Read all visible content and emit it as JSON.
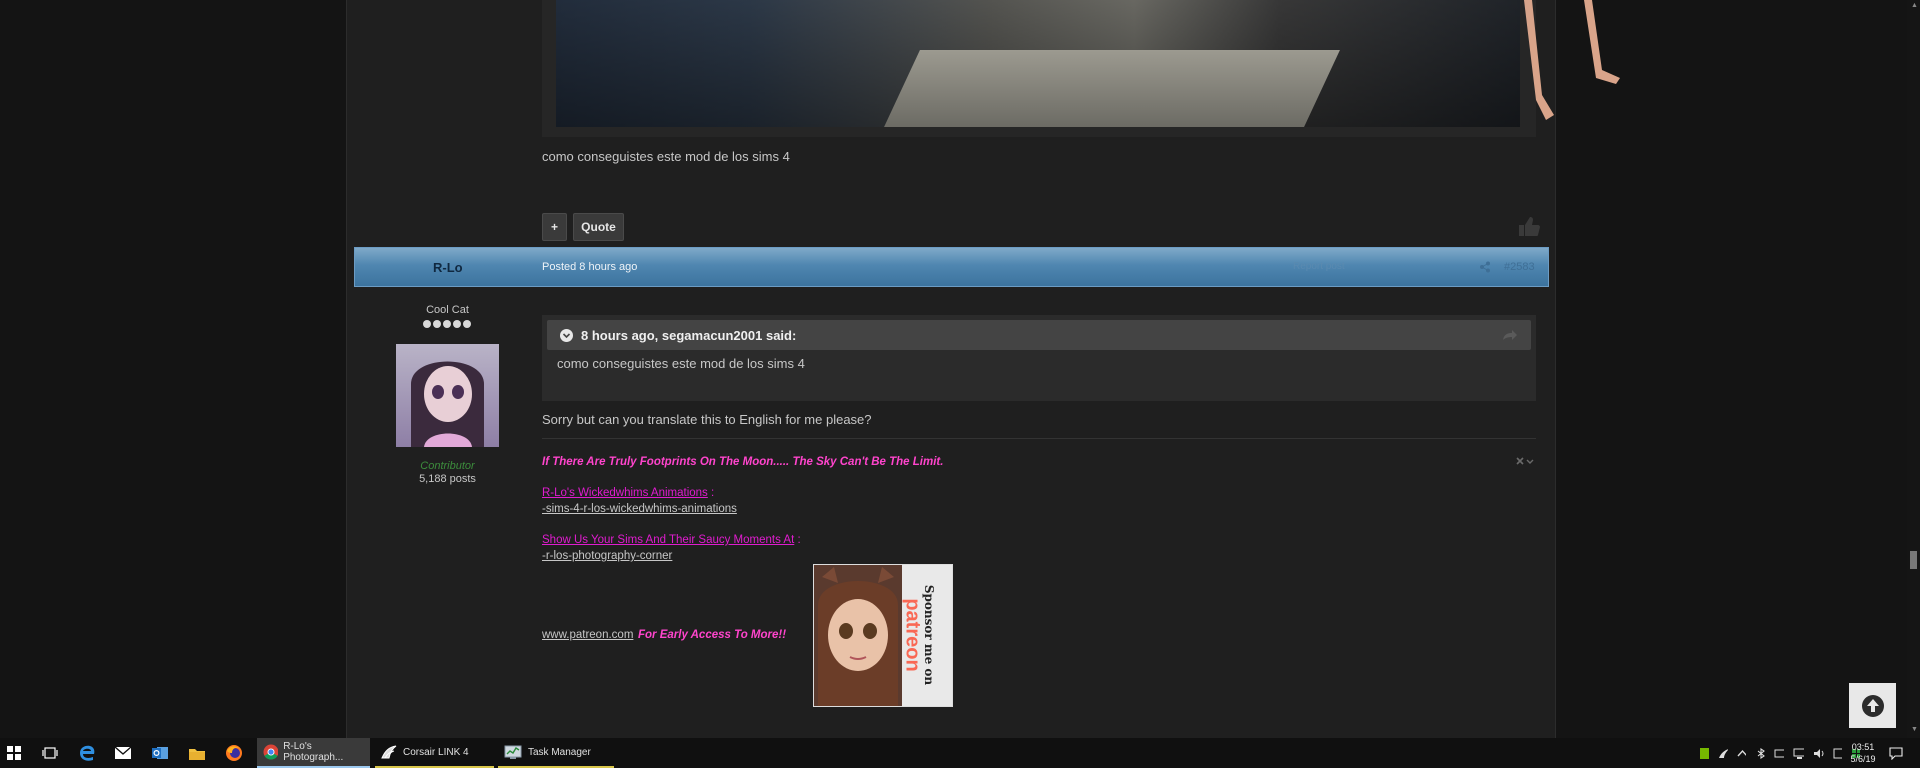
{
  "previous_post": {
    "comment": "como conseguistes este mod de los sims 4",
    "plus_label": "+",
    "quote_label": "Quote"
  },
  "post": {
    "author": "R-Lo",
    "posted": "Posted 8 hours ago",
    "report_text": "Report post",
    "number": "#2583",
    "rank": "Cool Cat",
    "role": "Contributor",
    "post_count": "5,188 posts",
    "quote": {
      "header": "8 hours ago, segamacun2001 said:",
      "body": "como conseguistes este mod de los sims 4"
    },
    "reply": "Sorry but can you translate this to English for me please?",
    "signature": {
      "tagline": "If There Are Truly Footprints On The Moon..... The Sky Can't Be The Limit.",
      "link1_label": "R-Lo's Wickedwhims Animations",
      "link1_sep": " :",
      "link1_url": "-sims-4-r-los-wickedwhims-animations",
      "link2_label": "Show Us Your Sims And Their Saucy Moments At",
      "link2_sep": " :",
      "link2_url": "-r-los-photography-corner",
      "patreon_link": "www.patreon.com",
      "patreon_text": "For Early Access To More!!",
      "banner_text_1": "Sponsor me on",
      "banner_text_2": "patreon"
    }
  },
  "taskbar": {
    "tasks": [
      {
        "label": "R-Lo's Photograph...",
        "icon": "chrome-icon"
      },
      {
        "label": "Corsair LINK 4",
        "icon": "corsair-icon"
      },
      {
        "label": "Task Manager",
        "icon": "task-manager-icon"
      }
    ],
    "time": "03:51",
    "date": "5/6/19"
  },
  "colors": {
    "header_blue": "#4f86b0",
    "contributor_green": "#3c8c3c",
    "signature_pink": "#ff44cc",
    "link_magenta": "#e01ccf"
  }
}
